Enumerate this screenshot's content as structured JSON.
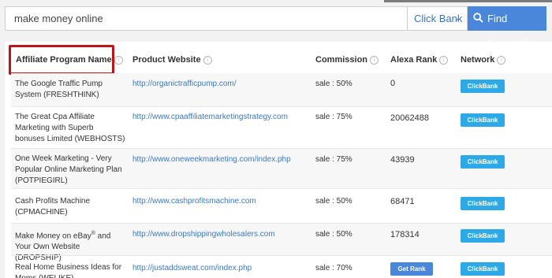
{
  "search": {
    "value": "make money online"
  },
  "network_select": {
    "value": "Click Bank"
  },
  "find_button": {
    "label": "Find Keywords"
  },
  "columns": [
    "Affiliate Program Name",
    "Product Website",
    "Commission",
    "Alexa Rank",
    "Network"
  ],
  "rows": [
    {
      "name": "The Google Traffic Pump System (FRESHTHINK)",
      "website": "http://organictrafficpump.com/",
      "commission": "sale : 50%",
      "alexa": "0",
      "network": "ClickBank"
    },
    {
      "name": "The Great Cpa Affiliate Marketing with Superb bonuses Limited (WEBHOSTS)",
      "website": "http://www.cpaaffiliatemarketingstrategy.com",
      "commission": "sale : 75%",
      "alexa": "20062488",
      "network": "ClickBank"
    },
    {
      "name": "One Week Marketing - Very Popular Online Marketing Plan (POTPIEGIRL)",
      "website": "http://www.oneweekmarketing.com/index.php",
      "commission": "sale : 75%",
      "alexa": "43939",
      "network": "ClickBank"
    },
    {
      "name": "Cash Profits Machine (CPMACHINE)",
      "website": "http://www.cashprofitsmachine.com",
      "commission": "sale : 50%",
      "alexa": "68471",
      "network": "ClickBank"
    },
    {
      "name_part1": "Make Money on eBay",
      "name_sup": "®",
      "name_part2": " and Your Own Website (DROPSHIP)",
      "website": "http://www.dropshippingwholesalers.com",
      "commission": "sale : 50%",
      "alexa": "178314",
      "network": "ClickBank"
    },
    {
      "name": "Real Home Business Ideas for Moms (WELIKE)",
      "website": "http://justaddsweat.com/index.php",
      "commission": "sale : 70%",
      "get_rank": "Get Rank",
      "network": "ClickBank"
    }
  ]
}
